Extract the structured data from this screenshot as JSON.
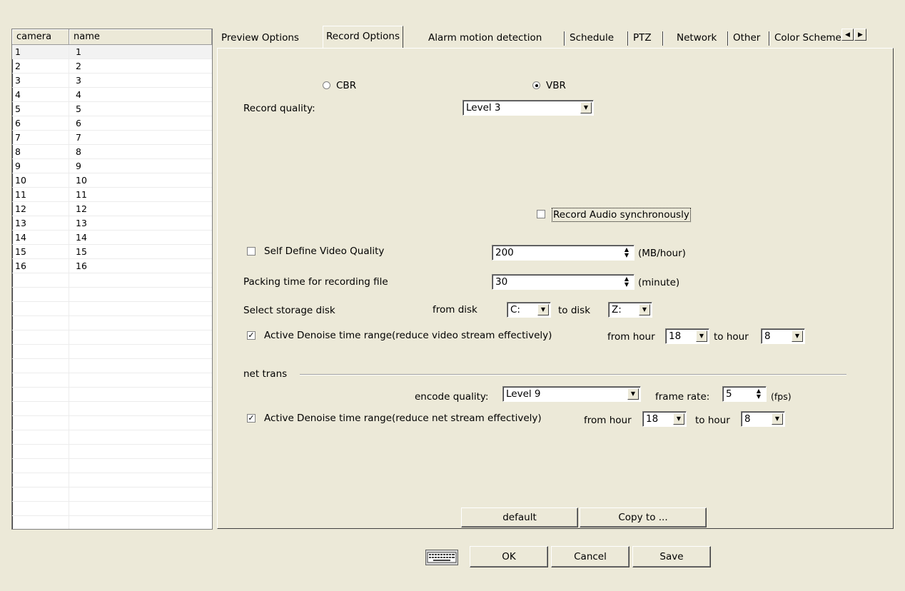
{
  "camera_table": {
    "headers": [
      "camera",
      "name"
    ],
    "rows": [
      [
        "1",
        "1"
      ],
      [
        "2",
        "2"
      ],
      [
        "3",
        "3"
      ],
      [
        "4",
        "4"
      ],
      [
        "5",
        "5"
      ],
      [
        "6",
        "6"
      ],
      [
        "7",
        "7"
      ],
      [
        "8",
        "8"
      ],
      [
        "9",
        "9"
      ],
      [
        "10",
        "10"
      ],
      [
        "11",
        "11"
      ],
      [
        "12",
        "12"
      ],
      [
        "13",
        "13"
      ],
      [
        "14",
        "14"
      ],
      [
        "15",
        "15"
      ],
      [
        "16",
        "16"
      ]
    ]
  },
  "tabs": [
    "Preview Options",
    "Record Options",
    "Alarm motion detection",
    "Schedule",
    "PTZ",
    "Network",
    "Other",
    "Color Scheme"
  ],
  "active_tab": "Record Options",
  "record": {
    "cbr_label": "CBR",
    "vbr_label": "VBR",
    "quality_label": "Record quality:",
    "quality_value": "Level 3",
    "audio_label": "Record Audio synchronously",
    "self_define_label": "Self Define Video Quality",
    "self_define_value": "200",
    "self_define_unit": "(MB/hour)",
    "packing_label": "Packing time for recording file",
    "packing_value": "30",
    "packing_unit": "(minute)",
    "storage_label": "Select storage disk",
    "from_disk_label": "from disk",
    "from_disk_value": "C:",
    "to_disk_label": "to disk",
    "to_disk_value": "Z:",
    "denoise_label": "Active Denoise time range(reduce video stream effectively)",
    "denoise_from_label": "from hour",
    "denoise_from_value": "18",
    "denoise_to_label": "to hour",
    "denoise_to_value": "8"
  },
  "net_trans": {
    "section_label": "net trans",
    "encode_label": "encode quality:",
    "encode_value": "Level 9",
    "frame_rate_label": "frame rate:",
    "frame_rate_value": "5",
    "frame_rate_unit": "(fps)",
    "denoise_label": "Active Denoise time range(reduce net stream effectively)",
    "from_label": "from hour",
    "from_value": "18",
    "to_label": "to hour",
    "to_value": "8"
  },
  "panel_buttons": {
    "default": "default",
    "copy_to": "Copy to ..."
  },
  "dialog_buttons": {
    "ok": "OK",
    "cancel": "Cancel",
    "save": "Save"
  }
}
